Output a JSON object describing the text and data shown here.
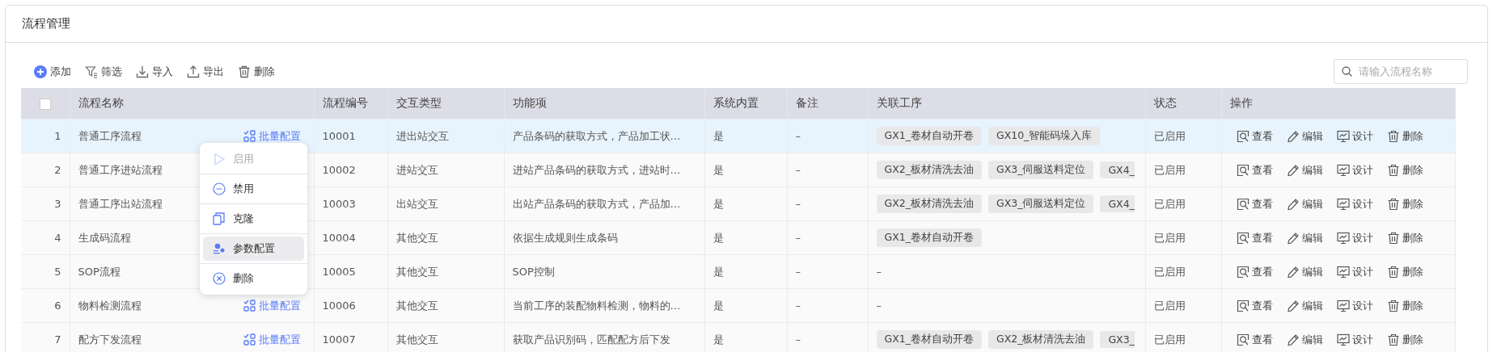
{
  "page": {
    "title": "流程管理"
  },
  "toolbar": [
    {
      "label": "添加"
    },
    {
      "label": "筛选"
    },
    {
      "label": "导入"
    },
    {
      "label": "导出"
    },
    {
      "label": "删除"
    }
  ],
  "search": {
    "placeholder": "请输入流程名称"
  },
  "table": {
    "select_all": {
      "checked": false
    },
    "columns": [
      "流程名称",
      "流程编号",
      "交互类型",
      "功能项",
      "系统内置",
      "备注",
      "关联工序",
      "状态",
      "操作"
    ],
    "rows": [
      {
        "index": "1",
        "name": "普通工序流程",
        "batch": "批量配置",
        "code": "10001",
        "type": "进出站交互",
        "function": "产品条码的获取方式，产品加工状…",
        "builtin": "是",
        "note": "–",
        "processes": [
          "GX1_卷材自动开卷",
          "GX10_智能码垛入库"
        ],
        "status": "已启用",
        "actions": [
          "查看",
          "编辑",
          "设计",
          "删除"
        ],
        "selected": true
      },
      {
        "index": "2",
        "name": "普通工序进站流程",
        "code": "10002",
        "type": "进站交互",
        "function": "进站产品条码的获取方式，进站时…",
        "builtin": "是",
        "note": "–",
        "processes": [
          "GX2_板材清洗去油",
          "GX3_伺服送料定位",
          "GX4_"
        ],
        "status": "已启用",
        "actions": [
          "查看",
          "编辑",
          "设计",
          "删除"
        ],
        "selected": false
      },
      {
        "index": "3",
        "name": "普通工序出站流程",
        "code": "10003",
        "type": "出站交互",
        "function": "出站产品条码的获取方式，产品加…",
        "builtin": "是",
        "note": "–",
        "processes": [
          "GX2_板材清洗去油",
          "GX3_伺服送料定位",
          "GX4_"
        ],
        "status": "已启用",
        "actions": [
          "查看",
          "编辑",
          "设计",
          "删除"
        ],
        "selected": false
      },
      {
        "index": "4",
        "name": "生成码流程",
        "code": "10004",
        "type": "其他交互",
        "function": "依据生成规则生成条码",
        "builtin": "是",
        "note": "–",
        "processes": [
          "GX1_卷材自动开卷"
        ],
        "status": "已启用",
        "actions": [
          "查看",
          "编辑",
          "设计",
          "删除"
        ],
        "selected": false
      },
      {
        "index": "5",
        "name": "SOP流程",
        "code": "10005",
        "type": "其他交互",
        "function": "SOP控制",
        "builtin": "是",
        "note": "–",
        "processes_text": "–",
        "status": "已启用",
        "actions": [
          "查看",
          "编辑",
          "设计",
          "删除"
        ],
        "selected": false
      },
      {
        "index": "6",
        "name": "物料检测流程",
        "batch": "批量配置",
        "code": "10006",
        "type": "其他交互",
        "function": "当前工序的装配物料检测，物料的…",
        "builtin": "是",
        "note": "–",
        "processes_text": "–",
        "status": "已启用",
        "actions": [
          "查看",
          "编辑",
          "设计",
          "删除"
        ],
        "selected": false
      },
      {
        "index": "7",
        "name": "配方下发流程",
        "batch": "批量配置",
        "code": "10007",
        "type": "其他交互",
        "function": "获取产品识别码，匹配配方后下发",
        "builtin": "是",
        "note": "–",
        "processes": [
          "GX1_卷材自动开卷",
          "GX2_板材清洗去油",
          "GX3_"
        ],
        "status": "已启用",
        "actions": [
          "查看",
          "编辑",
          "设计",
          "删除"
        ],
        "selected": false
      }
    ]
  },
  "context_menu": {
    "items": [
      {
        "label": "启用",
        "disabled": true,
        "highlighted": false
      },
      {
        "label": "禁用",
        "disabled": false,
        "highlighted": false
      },
      {
        "label": "克隆",
        "disabled": false,
        "highlighted": false
      },
      {
        "label": "参数配置",
        "disabled": false,
        "highlighted": true
      },
      {
        "label": "删除",
        "disabled": false,
        "highlighted": false
      }
    ]
  }
}
